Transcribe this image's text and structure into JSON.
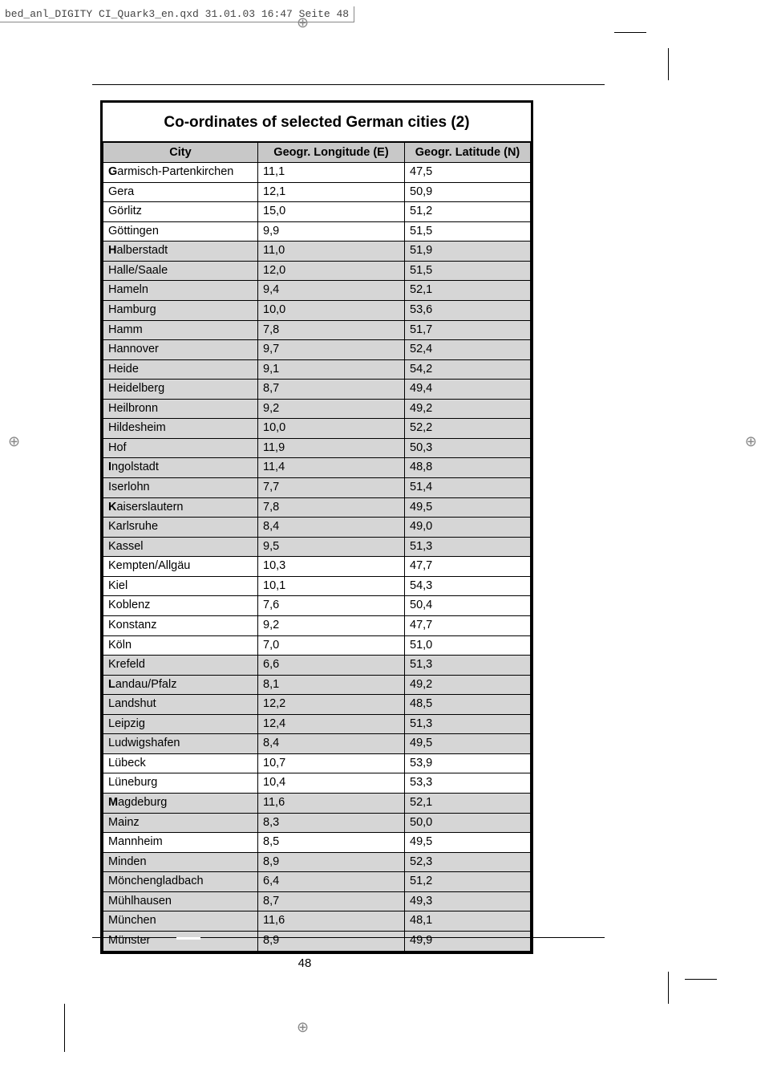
{
  "header_info": "bed_anl_DIGITY CI_Quark3_en.qxd  31.01.03  16:47  Seite 48",
  "title": "Co-ordinates of selected German cities (2)",
  "columns": {
    "city": "City",
    "lon": "Geogr. Longitude (E)",
    "lat": "Geogr. Latitude (N)"
  },
  "page_number": "48",
  "rows": [
    {
      "city": "Garmisch-Partenkirchen",
      "bold": true,
      "lon": "11,1",
      "lat": "47,5",
      "shade": false
    },
    {
      "city": "Gera",
      "lon": "12,1",
      "lat": "50,9",
      "shade": false
    },
    {
      "city": "Görlitz",
      "lon": "15,0",
      "lat": "51,2",
      "shade": false
    },
    {
      "city": "Göttingen",
      "lon": "9,9",
      "lat": "51,5",
      "shade": false
    },
    {
      "city": "Halberstadt",
      "bold": true,
      "lon": "11,0",
      "lat": "51,9",
      "shade": true
    },
    {
      "city": "Halle/Saale",
      "lon": "12,0",
      "lat": "51,5",
      "shade": true
    },
    {
      "city": "Hameln",
      "lon": "9,4",
      "lat": "52,1",
      "shade": true
    },
    {
      "city": "Hamburg",
      "lon": "10,0",
      "lat": "53,6",
      "shade": true
    },
    {
      "city": "Hamm",
      "lon": "7,8",
      "lat": "51,7",
      "shade": true
    },
    {
      "city": "Hannover",
      "lon": "9,7",
      "lat": "52,4",
      "shade": true
    },
    {
      "city": "Heide",
      "lon": "9,1",
      "lat": "54,2",
      "shade": true
    },
    {
      "city": "Heidelberg",
      "lon": "8,7",
      "lat": "49,4",
      "shade": true
    },
    {
      "city": "Heilbronn",
      "lon": "9,2",
      "lat": "49,2",
      "shade": true
    },
    {
      "city": "Hildesheim",
      "lon": "10,0",
      "lat": "52,2",
      "shade": true
    },
    {
      "city": "Hof",
      "lon": "11,9",
      "lat": "50,3",
      "shade": true
    },
    {
      "city": "Ingolstadt",
      "bold": true,
      "lon": "11,4",
      "lat": "48,8",
      "shade": true
    },
    {
      "city": "Iserlohn",
      "lon": "7,7",
      "lat": "51,4",
      "shade": true
    },
    {
      "city": "Kaiserslautern",
      "bold": true,
      "lon": "7,8",
      "lat": "49,5",
      "shade": true
    },
    {
      "city": "Karlsruhe",
      "lon": "8,4",
      "lat": "49,0",
      "shade": true
    },
    {
      "city": "Kassel",
      "lon": "9,5",
      "lat": "51,3",
      "shade": true
    },
    {
      "city": "Kempten/Allgäu",
      "lon": "10,3",
      "lat": "47,7",
      "shade": false
    },
    {
      "city": "Kiel",
      "lon": "10,1",
      "lat": "54,3",
      "shade": false
    },
    {
      "city": "Koblenz",
      "lon": "7,6",
      "lat": "50,4",
      "shade": false
    },
    {
      "city": "Konstanz",
      "lon": "9,2",
      "lat": "47,7",
      "shade": false
    },
    {
      "city": "Köln",
      "lon": "7,0",
      "lat": "51,0",
      "shade": false
    },
    {
      "city": "Krefeld",
      "lon": "6,6",
      "lat": "51,3",
      "shade": true
    },
    {
      "city": "Landau/Pfalz",
      "bold": true,
      "lon": "8,1",
      "lat": "49,2",
      "shade": true
    },
    {
      "city": "Landshut",
      "lon": "12,2",
      "lat": "48,5",
      "shade": true
    },
    {
      "city": "Leipzig",
      "lon": "12,4",
      "lat": "51,3",
      "shade": true
    },
    {
      "city": "Ludwigshafen",
      "lon": "8,4",
      "lat": "49,5",
      "shade": true
    },
    {
      "city": "Lübeck",
      "lon": "10,7",
      "lat": "53,9",
      "shade": false
    },
    {
      "city": "Lüneburg",
      "lon": "10,4",
      "lat": "53,3",
      "shade": false
    },
    {
      "city": "Magdeburg",
      "bold": true,
      "lon": "11,6",
      "lat": "52,1",
      "shade": true
    },
    {
      "city": "Mainz",
      "lon": "8,3",
      "lat": "50,0",
      "shade": true
    },
    {
      "city": "Mannheim",
      "lon": "8,5",
      "lat": "49,5",
      "shade": false
    },
    {
      "city": "Minden",
      "lon": "8,9",
      "lat": "52,3",
      "shade": true
    },
    {
      "city": "Mönchengladbach",
      "lon": "6,4",
      "lat": "51,2",
      "shade": true
    },
    {
      "city": "Mühlhausen",
      "lon": "8,7",
      "lat": "49,3",
      "shade": true
    },
    {
      "city": "München",
      "lon": "11,6",
      "lat": "48,1",
      "shade": true
    },
    {
      "city": "Münster",
      "lon": "8,9",
      "lat": "49,9",
      "shade": true
    }
  ]
}
